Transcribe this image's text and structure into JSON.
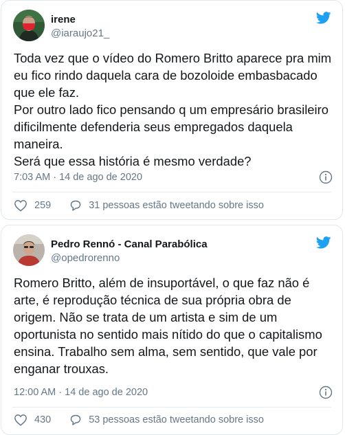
{
  "tweets": [
    {
      "author_name": "irene",
      "handle": "@iaraujo21_",
      "paragraphs": [
        "Toda vez que o vídeo do Romero Britto aparece pra mim eu fico rindo daquela cara de bozoloide embasbacado que ele faz.",
        "Por outro lado fico pensando q um empresário brasileiro dificilmente defenderia seus empregados daquela maneira.",
        "Será que essa história é mesmo verdade?"
      ],
      "timestamp": "7:03 AM · 14 de ago de 2020",
      "likes": "259",
      "conversation": "31 pessoas estão tweetando sobre isso",
      "avatar_icon": "avatar-red-mask"
    },
    {
      "author_name": "Pedro Rennó - Canal Parabólica",
      "handle": "@opedrorenno",
      "paragraphs": [
        "Romero Britto, além de insuportável, o que faz não é arte, é reprodução técnica de sua própria obra de origem. Não se trata de um artista e sim de um oportunista no sentido mais nítido do que o capitalismo ensina. Trabalho sem alma, sem sentido, que vale por enganar trouxas."
      ],
      "timestamp": "12:00 AM · 14 de ago de 2020",
      "likes": "430",
      "conversation": "53 pessoas estão tweetando sobre isso",
      "avatar_icon": "avatar-man-red-shirt"
    }
  ],
  "colors": {
    "twitter_blue": "#1da1f2",
    "text": "#14171a",
    "secondary": "#657786",
    "border": "#e1e8ed"
  }
}
